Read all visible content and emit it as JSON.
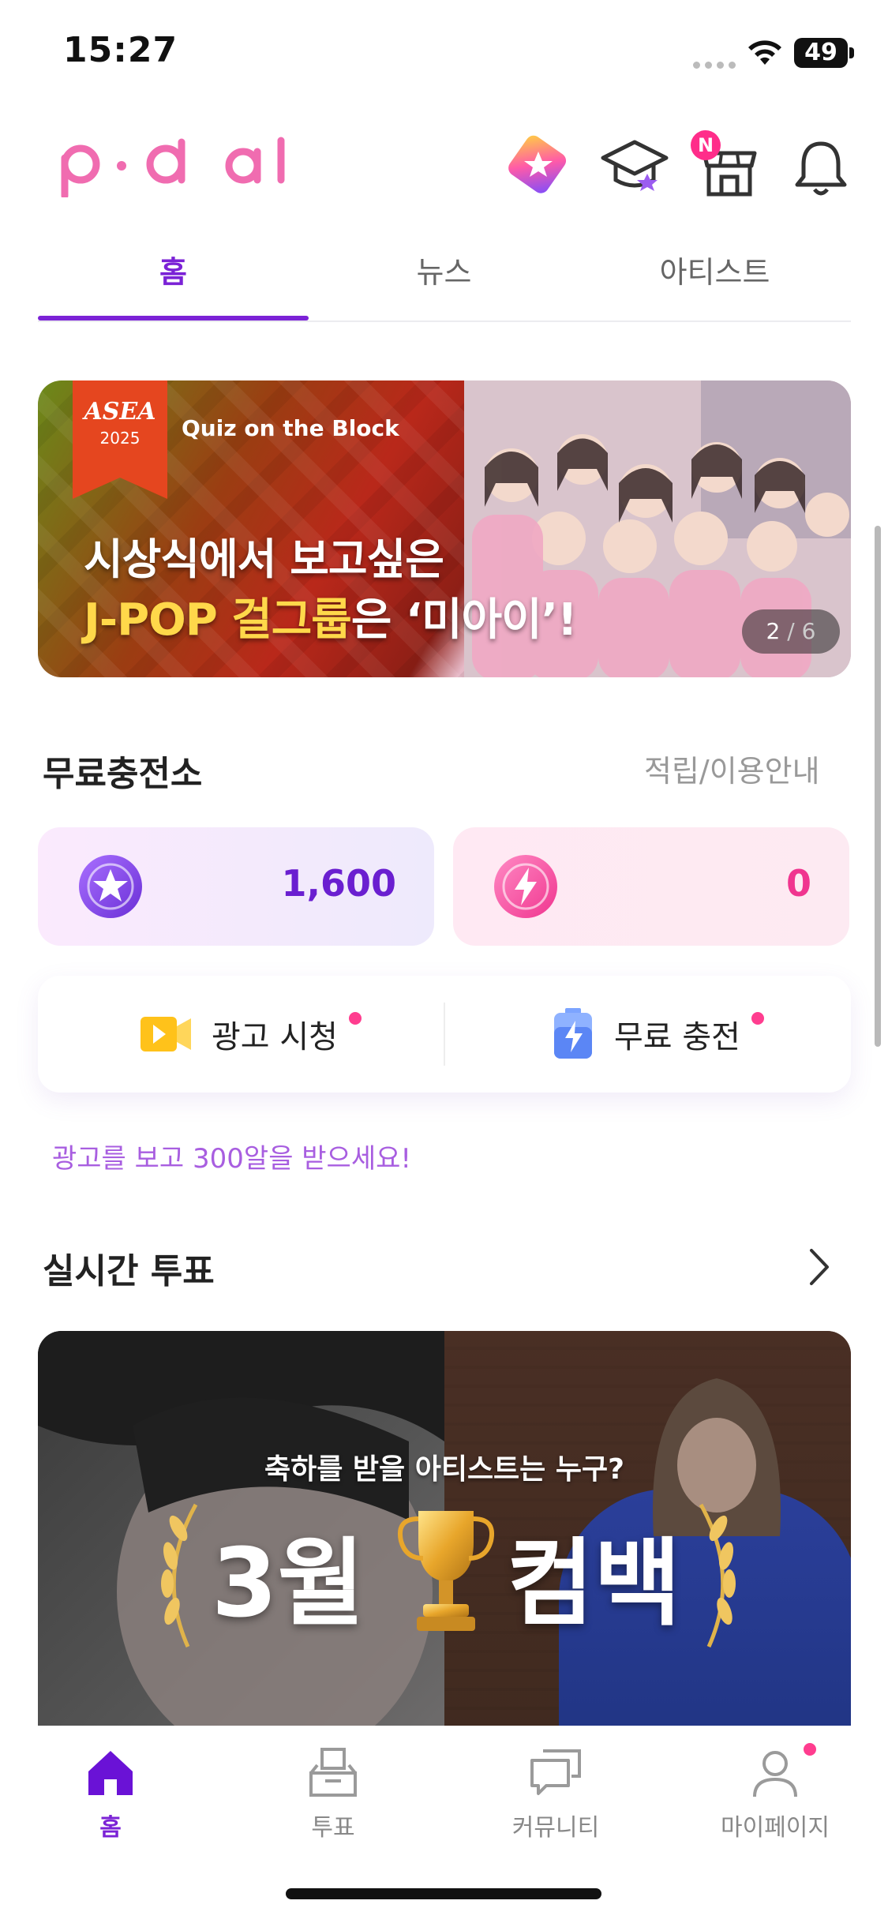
{
  "status_bar": {
    "time": "15:27",
    "battery": "49"
  },
  "header": {
    "logo": "p·d al",
    "icons": [
      "ticket-icon",
      "graduation-cap-icon",
      "store-icon",
      "bell-icon"
    ],
    "store_badge": "N"
  },
  "tabs": [
    {
      "label": "홈",
      "active": true
    },
    {
      "label": "뉴스",
      "active": false
    },
    {
      "label": "아티스트",
      "active": false
    }
  ],
  "banner": {
    "brand": "ASEA",
    "year": "2025",
    "quiz_title": "Quiz on the Block",
    "line1": "시상식에서 보고싶은",
    "line2_highlight": "J-POP 걸그룹",
    "line2_plain": "은",
    "line2_name": "‘미아이’!",
    "pager_current": "2",
    "pager_sep": " / ",
    "pager_total": "6"
  },
  "free_charge": {
    "title": "무료충전소",
    "link": "적립/이용안내",
    "star_points": "1,600",
    "bolt_points": "0",
    "ad_watch": "광고 시청",
    "free_charge": "무료 충전",
    "promo": "광고를 보고 300알을 받으세요!"
  },
  "realtime_vote": {
    "title": "실시간 투표",
    "subtitle": "축하를 받을 아티스트는 누구?",
    "big_left": "3월",
    "big_right": "컴백"
  },
  "bottom_nav": [
    {
      "label": "홈",
      "icon": "home-icon",
      "active": true
    },
    {
      "label": "투표",
      "icon": "vote-icon",
      "active": false
    },
    {
      "label": "커뮤니티",
      "icon": "community-icon",
      "active": false
    },
    {
      "label": "마이페이지",
      "icon": "profile-icon",
      "active": false
    }
  ],
  "colors": {
    "accent": "#7b22d6",
    "pink": "#ff3d8f",
    "logo_pink": "#f06cb0"
  }
}
